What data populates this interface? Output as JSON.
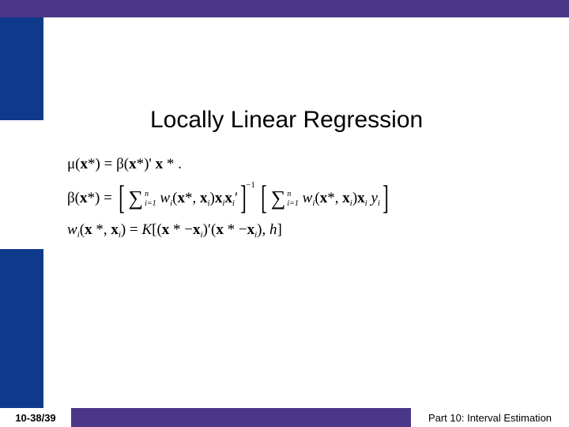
{
  "title": "Locally Linear Regression",
  "math": {
    "line1": {
      "lhs": "μ(x*) = ",
      "rhs": "β(x*)' x * ."
    },
    "line2": {
      "lhs": "β(x*) = ",
      "sum_upper": "n",
      "sum_lower_a": "i=1",
      "term_a": "wᵢ(x*, xᵢ) xᵢ xᵢ′",
      "exp_inv": "−1",
      "sum_lower_b": "i=1",
      "term_b": "wᵢ(x*, xᵢ) xᵢ yᵢ"
    },
    "line3": {
      "lhs": "wᵢ(x *, xᵢ) = ",
      "rhs": "K[(x * −xᵢ)′(x * −xᵢ), h]"
    }
  },
  "footer": {
    "page": "10-38/39",
    "part": "Part 10: Interval Estimation"
  }
}
